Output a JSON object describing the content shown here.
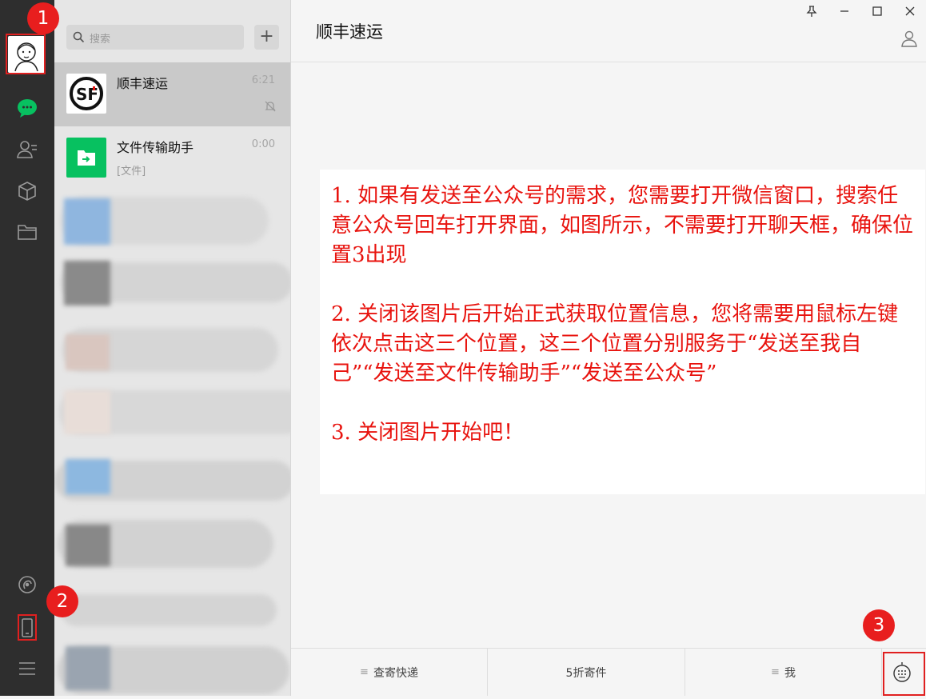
{
  "rail": {
    "icons": [
      "avatar",
      "chat-icon",
      "contacts-icon",
      "cube-icon",
      "folder-icon",
      "moments-icon",
      "phone-icon",
      "menu-icon"
    ]
  },
  "annotations": {
    "badge_1": "1",
    "badge_2": "2",
    "badge_3": "3",
    "color": "#e81e1e"
  },
  "search": {
    "placeholder": "搜索",
    "add_label": "+"
  },
  "chats": [
    {
      "name": "顺丰速运",
      "time": "6:21",
      "sub": "",
      "muted": true,
      "avatar_text": "SF"
    },
    {
      "name": "文件传输助手",
      "time": "0:00",
      "sub": "[文件]"
    }
  ],
  "main": {
    "title": "顺丰速运",
    "window_controls": [
      "pin-icon",
      "minimize-icon",
      "maximize-icon",
      "close-icon"
    ],
    "note_lines": [
      "1. 如果有发送至公众号的需求，您需要打开微信窗口，搜索任意公众号回车打开界面，如图所示，不需要打开聊天框，确保位置3出现",
      "2. 关闭该图片后开始正式获取位置信息，您将需要用鼠标左键依次点击这三个位置，这三个位置分别服务于“发送至我自己”“发送至文件传输助手”“发送至公众号”",
      "3. 关闭图片开始吧！"
    ],
    "menu": [
      {
        "label": "查寄快递",
        "has_list_glyph": true
      },
      {
        "label": "5折寄件",
        "has_list_glyph": false
      },
      {
        "label": "我",
        "has_list_glyph": true
      }
    ]
  },
  "colors": {
    "accent_green": "#07c160",
    "note_red": "#e8130e",
    "rail_bg": "#2e2e2e"
  }
}
